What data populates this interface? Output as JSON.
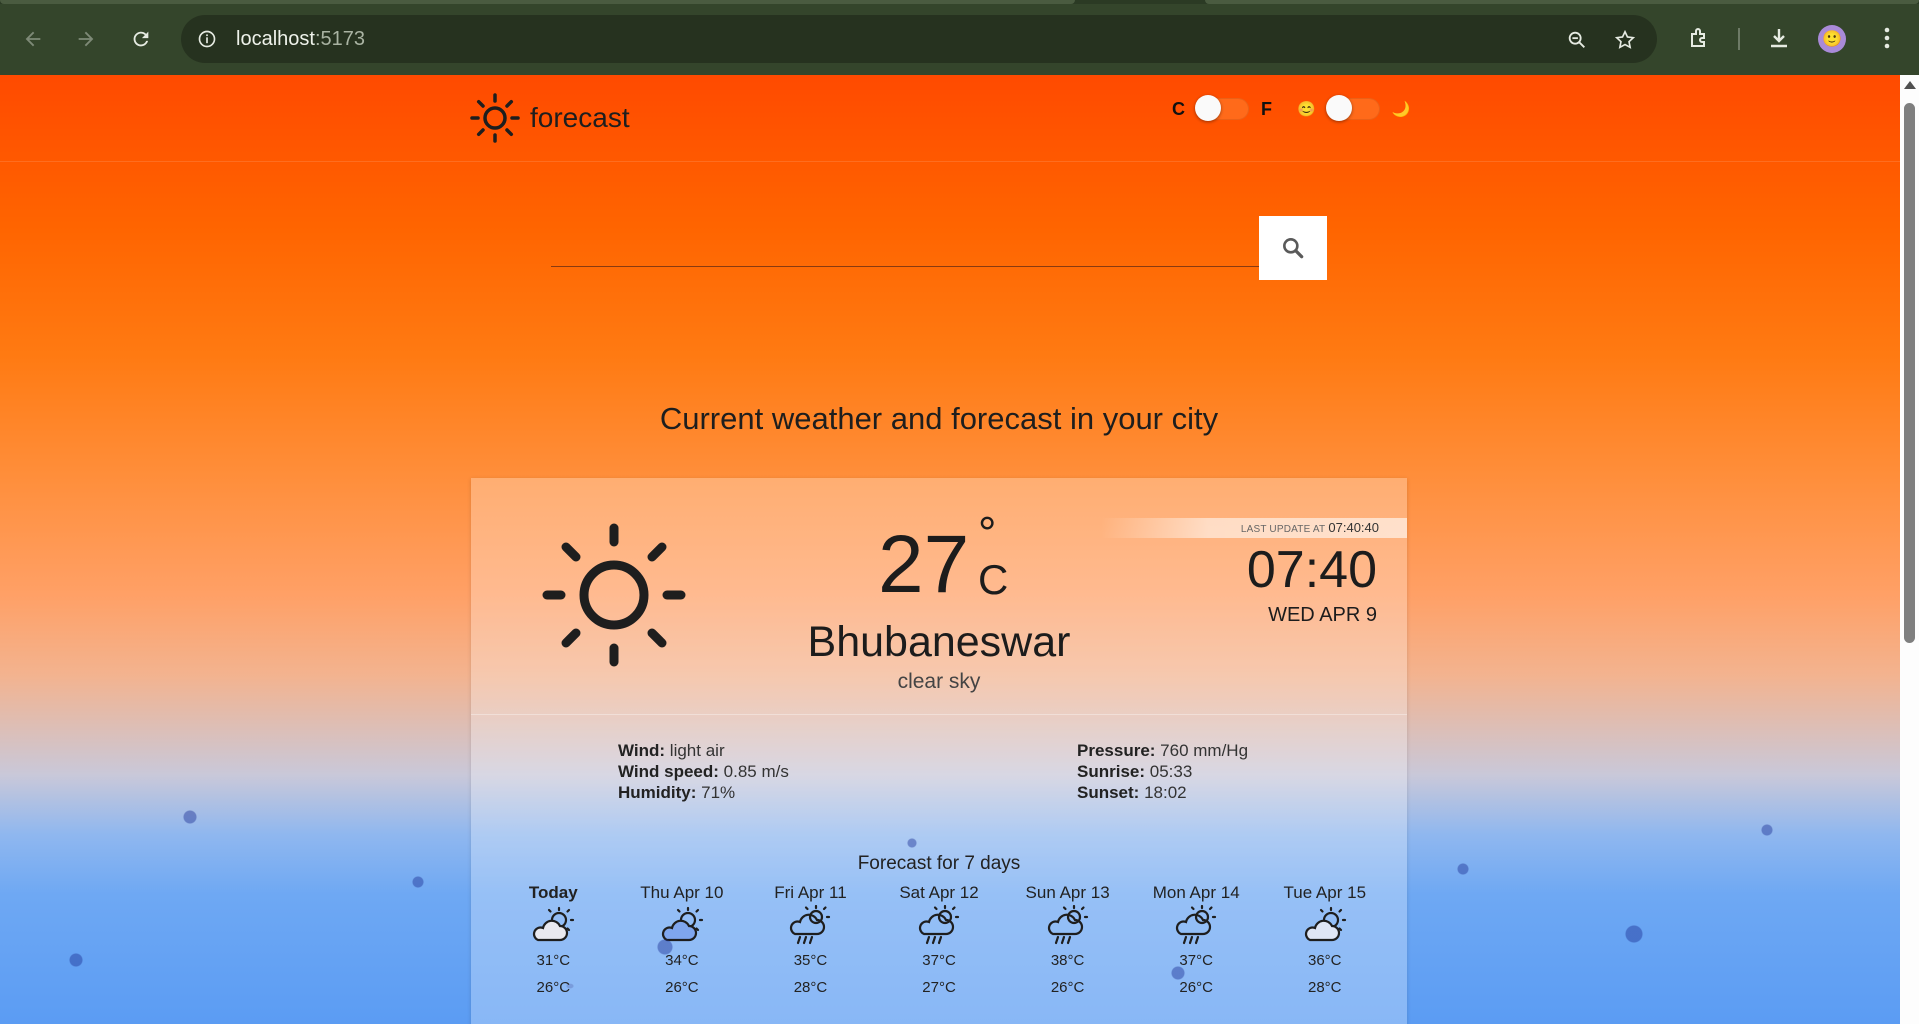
{
  "browser": {
    "url_host": "localhost",
    "url_port": ":5173"
  },
  "header": {
    "logo_text": "forecast",
    "unit_c": "C",
    "unit_f": "F",
    "theme_light_icon": "😊",
    "theme_dark_icon": "🌙"
  },
  "search": {
    "placeholder": ""
  },
  "headline": "Current weather and forecast in your city",
  "current": {
    "temperature": "27",
    "degree_symbol": "°",
    "unit": "C",
    "city": "Bhubaneswar",
    "description": "clear sky",
    "last_update_label": "LAST UPDATE AT",
    "last_update_time": "07:40:40",
    "clock": "07:40",
    "date": "WED APR 9",
    "icon": "clear-sky-sun-icon"
  },
  "details": {
    "wind_label": "Wind:",
    "wind_value": "light air",
    "wind_speed_label": "Wind speed:",
    "wind_speed_value": "0.85 m/s",
    "humidity_label": "Humidity:",
    "humidity_value": "71%",
    "pressure_label": "Pressure:",
    "pressure_value": "760 mm/Hg",
    "sunrise_label": "Sunrise:",
    "sunrise_value": "05:33",
    "sunset_label": "Sunset:",
    "sunset_value": "18:02"
  },
  "forecast": {
    "title": "Forecast for 7 days",
    "days": [
      {
        "name": "Today",
        "icon": "partly-cloudy-icon",
        "high": "31°C",
        "low": "26°C"
      },
      {
        "name": "Thu Apr 10",
        "icon": "partly-cloudy-icon",
        "high": "34°C",
        "low": "26°C"
      },
      {
        "name": "Fri Apr 11",
        "icon": "rain-icon",
        "high": "35°C",
        "low": "28°C"
      },
      {
        "name": "Sat Apr 12",
        "icon": "rain-icon",
        "high": "37°C",
        "low": "27°C"
      },
      {
        "name": "Sun Apr 13",
        "icon": "rain-icon",
        "high": "38°C",
        "low": "26°C"
      },
      {
        "name": "Mon Apr 14",
        "icon": "rain-icon",
        "high": "37°C",
        "low": "26°C"
      },
      {
        "name": "Tue Apr 15",
        "icon": "partly-cloudy-icon",
        "high": "36°C",
        "low": "28°C"
      }
    ]
  },
  "colors": {
    "sky_top": "#ff4a00",
    "sand": "#5b9cf3",
    "switch": "#ff6a1a",
    "browser_frame": "#34452b"
  }
}
